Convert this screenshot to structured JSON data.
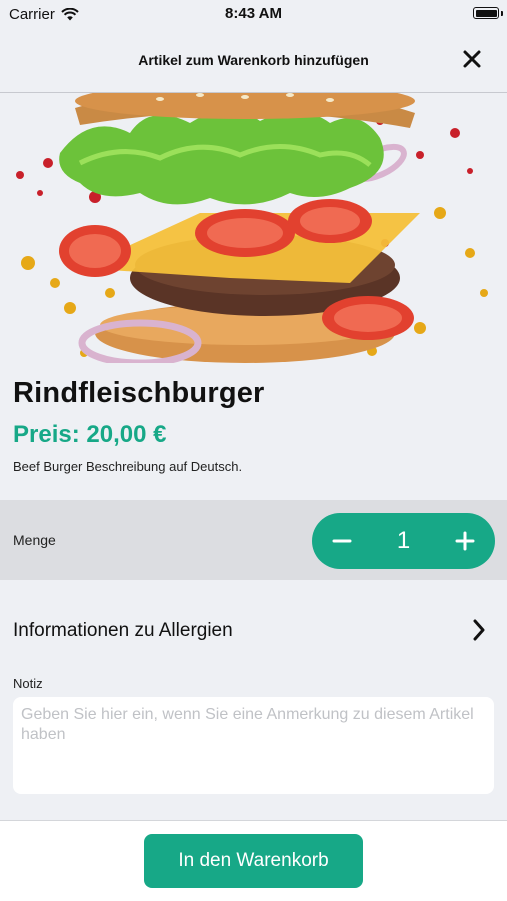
{
  "status_bar": {
    "carrier": "Carrier",
    "time": "8:43 AM"
  },
  "nav": {
    "title": "Artikel zum Warenkorb hinzufügen"
  },
  "product": {
    "name": "Rindfleischburger",
    "price": "Preis: 20,00 €",
    "description": "Beef Burger Beschreibung auf Deutsch."
  },
  "quantity": {
    "label": "Menge",
    "value": "1",
    "minus": "−",
    "plus": "+"
  },
  "allergy": {
    "label": "Informationen zu Allergien"
  },
  "note": {
    "label": "Notiz",
    "placeholder": "Geben Sie hier ein, wenn Sie eine Anmerkung zu diesem Artikel haben"
  },
  "footer": {
    "add_to_cart": "In den Warenkorb"
  },
  "colors": {
    "accent": "#17a887",
    "background": "#eef0f4"
  }
}
